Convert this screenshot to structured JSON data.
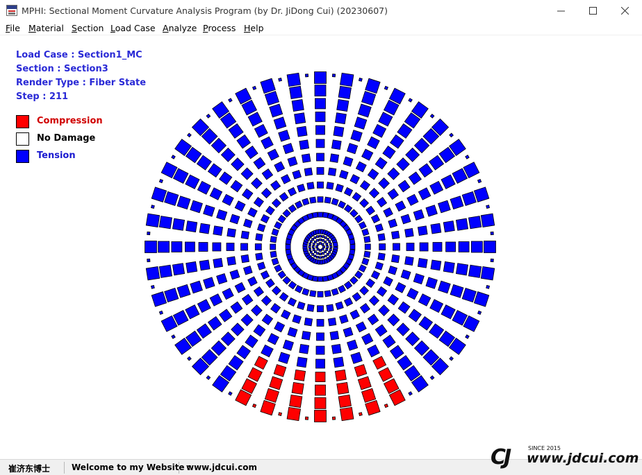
{
  "window": {
    "title": "MPHI: Sectional Moment Curvature Analysis Program (by Dr. JiDong Cui) (20230607)",
    "icon": "mphi-app-icon",
    "controls": [
      "minimize-icon",
      "maximize-icon",
      "close-icon"
    ]
  },
  "menu": {
    "items": [
      {
        "first": "F",
        "rest": "ile"
      },
      {
        "first": "M",
        "rest": "aterial"
      },
      {
        "first": "S",
        "rest": "ection"
      },
      {
        "first": "L",
        "rest": "oad Case"
      },
      {
        "first": "A",
        "rest": "nalyze"
      },
      {
        "first": "P",
        "rest": "rocess"
      },
      {
        "first": "H",
        "rest": "elp"
      }
    ]
  },
  "info": {
    "load_case": "Load Case : Section1_MC",
    "section": "Section : Section3",
    "render_type": "Render Type : Fiber State",
    "step": "Step : 211"
  },
  "legend": {
    "items": [
      {
        "label": "Compression",
        "color": "#ff0000",
        "text_color": "#d00000"
      },
      {
        "label": "No Damage",
        "color": "#ffffff",
        "text_color": "#000000"
      },
      {
        "label": "Tension",
        "color": "#0000ff",
        "text_color": "#1a1ad0"
      }
    ]
  },
  "section_render": {
    "state_colors": {
      "compression": "#ff0000",
      "tension": "#0000ff",
      "no_damage": "#ffffff"
    },
    "outline_color": "#000000",
    "rays": 40,
    "rings": 12,
    "compression_angle_range_deg": [
      63,
      117
    ],
    "inner_ring_count": 4
  },
  "status": {
    "author": "崔济东博士",
    "welcome": "Welcome to my Website :",
    "website": "www.jdcui.com"
  },
  "logo": {
    "mark": "CJ",
    "since": "SINCE 2015",
    "url": "www.jdcui.com"
  }
}
